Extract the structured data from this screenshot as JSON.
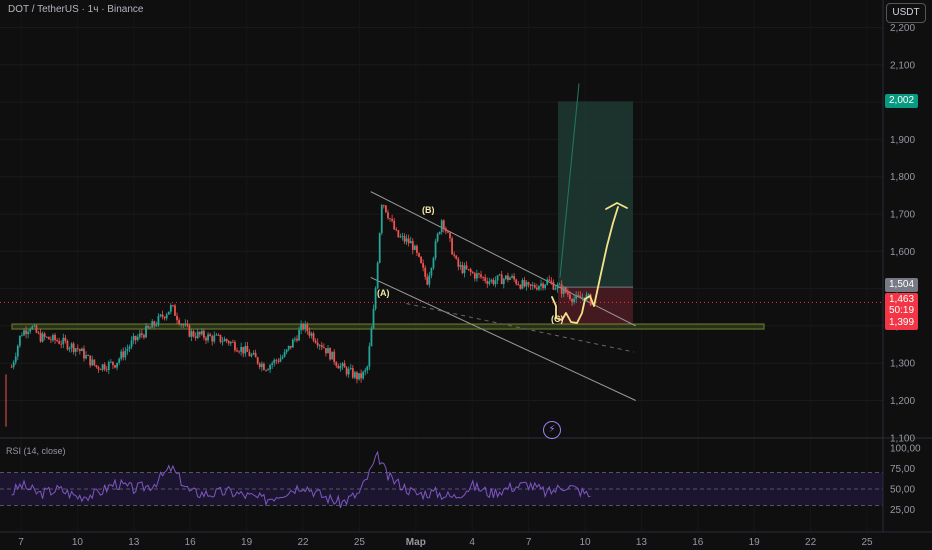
{
  "header": {
    "symbol_line": "DOT / TetherUS · 1ч · Binance",
    "currency": "USDT"
  },
  "rsi": {
    "label": "RSI (14, close)"
  },
  "price_badges": {
    "target": "2,002",
    "entry": "1,504",
    "current": "1,463",
    "countdown": "50:19",
    "stop": "1,399"
  },
  "waves": {
    "a": "(A)",
    "b": "(B)",
    "c": "(C)"
  },
  "colors": {
    "up": "#26a69a",
    "down": "#ef5350",
    "rsi": "#7e57c2",
    "projection": "#f5e38a",
    "target_zone": "#1e3a33",
    "stop_zone": "#4a1c22"
  },
  "chart_data": [
    {
      "type": "candlestick",
      "symbol": "DOT / TetherUS",
      "timeframe": "1ч",
      "exchange": "Binance",
      "price_axis_ticks": [
        "2,200",
        "2,100",
        "2,000",
        "1,900",
        "1,800",
        "1,700",
        "1,600",
        "1,500",
        "1,400",
        "1,300",
        "1,200",
        "1,100"
      ],
      "ylim": [
        1.1,
        2.2
      ],
      "date_axis_ticks": [
        "7",
        "10",
        "13",
        "16",
        "19",
        "22",
        "25",
        "Мар",
        "4",
        "7",
        "10",
        "13",
        "16",
        "19",
        "22",
        "25"
      ],
      "price_path_dates": [
        6.5,
        7,
        7.5,
        8,
        9,
        10,
        11,
        12,
        13,
        14,
        15,
        15.5,
        16,
        17,
        18,
        19,
        20,
        21,
        22,
        23,
        24,
        25,
        25.4,
        25.8,
        26.2,
        27,
        27.8,
        28.6,
        29.4,
        30.2,
        31,
        32,
        33,
        34,
        35,
        36,
        36.5,
        37,
        37.4
      ],
      "price_path_values": [
        1.29,
        1.38,
        1.4,
        1.37,
        1.36,
        1.34,
        1.29,
        1.3,
        1.36,
        1.4,
        1.45,
        1.41,
        1.38,
        1.37,
        1.36,
        1.33,
        1.29,
        1.32,
        1.4,
        1.35,
        1.29,
        1.26,
        1.28,
        1.46,
        1.74,
        1.64,
        1.62,
        1.52,
        1.69,
        1.56,
        1.54,
        1.52,
        1.53,
        1.5,
        1.52,
        1.49,
        1.47,
        1.48,
        1.463
      ],
      "horizontal_zone": [
        1.395,
        1.405
      ],
      "current_price": 1.463,
      "position": {
        "entry": 1.504,
        "target": 2.002,
        "stop": 1.399
      },
      "annotations": [
        "(A)",
        "(B)",
        "(C)"
      ]
    },
    {
      "type": "line",
      "title": "RSI (14, close)",
      "ylim": [
        0,
        100
      ],
      "axis_ticks": [
        "100,00",
        "75,00",
        "50,00",
        "25,00"
      ],
      "levels": [
        70,
        50,
        30
      ],
      "rsi_path_dates": [
        6.5,
        7,
        8,
        9,
        10,
        11,
        12,
        13,
        14,
        15,
        16,
        17,
        18,
        19,
        20,
        21,
        22,
        23,
        24,
        25,
        25.5,
        26,
        26.5,
        27,
        28,
        29,
        30,
        31,
        32,
        33,
        34,
        35,
        36,
        37,
        37.4
      ],
      "rsi_values": [
        45,
        55,
        44,
        50,
        41,
        44,
        57,
        50,
        55,
        76,
        46,
        44,
        47,
        42,
        37,
        46,
        55,
        42,
        33,
        45,
        68,
        91,
        65,
        58,
        44,
        46,
        40,
        54,
        45,
        52,
        56,
        45,
        55,
        45,
        40
      ]
    }
  ]
}
